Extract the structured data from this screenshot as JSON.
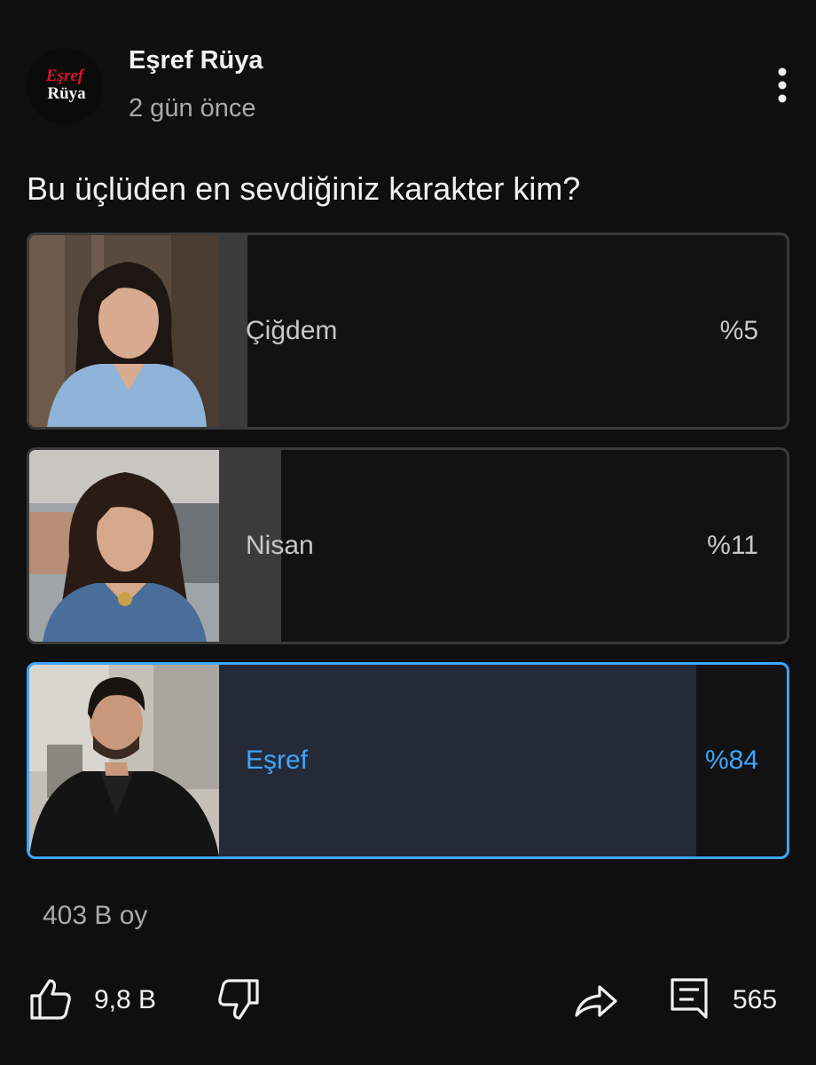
{
  "post": {
    "channel_name": "Eşref Rüya",
    "time_ago": "2 gün önce",
    "avatar_text_line1": "Eşref",
    "avatar_text_line2": "Rüya",
    "more_icon": "more-vert-icon"
  },
  "poll": {
    "question": "Bu üçlüden en sevdiğiniz karakter kim?",
    "options": [
      {
        "label": "Çiğdem",
        "percent_text": "%5",
        "percent": 5,
        "selected": false
      },
      {
        "label": "Nisan",
        "percent_text": "%11",
        "percent": 11,
        "selected": false
      },
      {
        "label": "Eşref",
        "percent_text": "%84",
        "percent": 84,
        "selected": true
      }
    ],
    "vote_count": "403 B oy"
  },
  "actions": {
    "like_count": "9,8 B",
    "comment_count": "565",
    "like_icon": "thumbs-up-icon",
    "dislike_icon": "thumbs-down-icon",
    "share_icon": "share-icon",
    "comment_icon": "comment-icon"
  },
  "colors": {
    "background": "#0f0f0f",
    "accent": "#3ea6ff",
    "selected_fill": "#252a38",
    "result_fill": "#3b3b3b",
    "brand_red": "#e0102a"
  }
}
